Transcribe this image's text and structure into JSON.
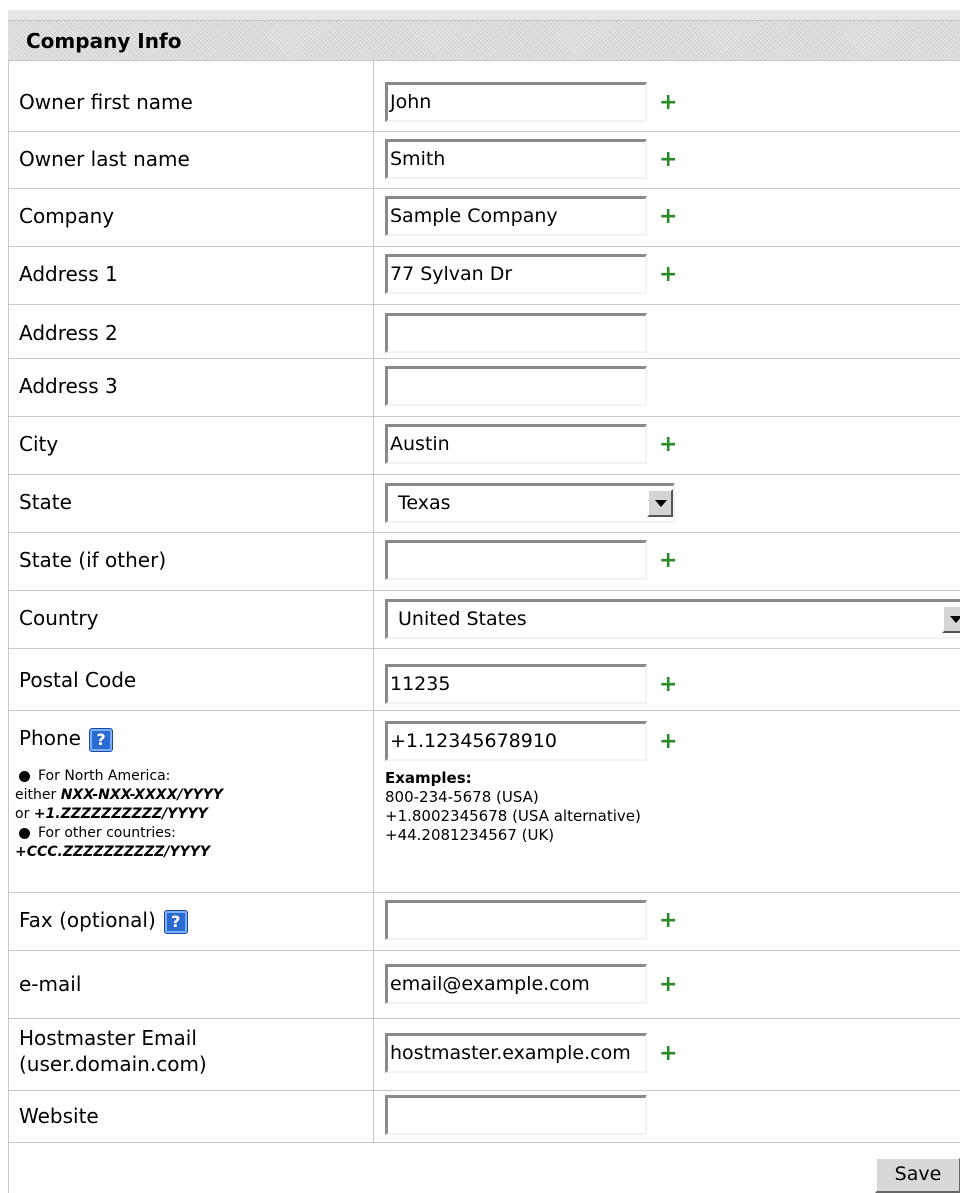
{
  "header": {
    "title": "Company Info"
  },
  "fields": {
    "owner_first_name": {
      "label": "Owner first name",
      "value": "John",
      "required": "+"
    },
    "owner_last_name": {
      "label": "Owner last name",
      "value": "Smith",
      "required": "+"
    },
    "company": {
      "label": "Company",
      "value": "Sample Company",
      "required": "+"
    },
    "address1": {
      "label": "Address 1",
      "value": "77 Sylvan Dr",
      "required": "+"
    },
    "address2": {
      "label": "Address 2",
      "value": ""
    },
    "address3": {
      "label": "Address 3",
      "value": ""
    },
    "city": {
      "label": "City",
      "value": "Austin",
      "required": "+"
    },
    "state": {
      "label": "State",
      "value": "Texas"
    },
    "state_other": {
      "label": "State (if other)",
      "value": "",
      "required": "+"
    },
    "country": {
      "label": "Country",
      "value": "United States"
    },
    "postal_code": {
      "label": "Postal Code",
      "value": "11235",
      "required": "+"
    },
    "phone": {
      "label": "Phone",
      "value": "+1.12345678910",
      "required": "+",
      "help": "?",
      "note": {
        "na_label": "For North America:",
        "either": "either",
        "na_format1": "NXX-NXX-XXXX/YYYY",
        "or": "or",
        "na_format2": "+1.ZZZZZZZZZZ/YYYY",
        "other_label": "For other countries:",
        "other_format": "+CCC.ZZZZZZZZZZ/YYYY"
      },
      "examples": {
        "title": "Examples:",
        "lines": [
          "800-234-5678  (USA)",
          "+1.8002345678  (USA alternative)",
          "+44.2081234567  (UK)"
        ]
      }
    },
    "fax": {
      "label": "Fax (optional)",
      "value": "",
      "required": "+",
      "help": "?"
    },
    "email": {
      "label": "e-mail",
      "value": "email@example.com",
      "required": "+"
    },
    "hostmaster": {
      "label_line1": "Hostmaster Email",
      "label_line2": "(user.domain.com)",
      "value": "hostmaster.example.com",
      "required": "+"
    },
    "website": {
      "label": "Website",
      "value": ""
    }
  },
  "footer": {
    "save_label": "Save"
  },
  "colors": {
    "required_plus": "#2a8a2a",
    "help_icon": "#2a6bd0"
  },
  "icons": {
    "help": "question-mark-icon",
    "select_arrow": "chevron-down-icon"
  }
}
